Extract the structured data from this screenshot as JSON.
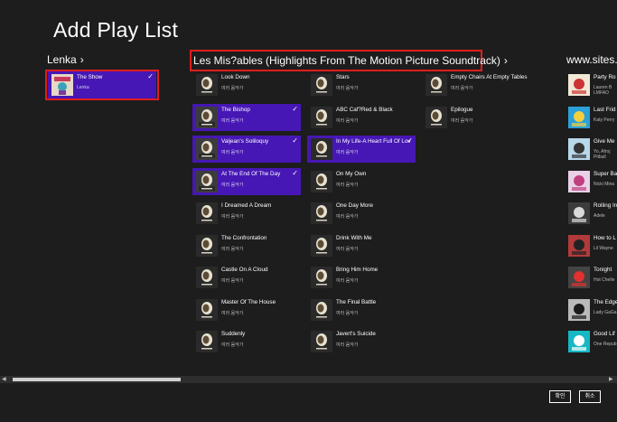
{
  "page_title": "Add Play List",
  "groups": {
    "lenka": "Lenka",
    "lesmis": "Les Mis?ables (Highlights From The Motion Picture Soundtrack)",
    "sites": "www.sites.go"
  },
  "chevron": "›",
  "lenka_items": [
    {
      "title": "The Show",
      "sub": "Lenka"
    }
  ],
  "lesmis_col1": [
    {
      "title": "Look Down",
      "sub": "여러 음악가"
    },
    {
      "title": "The Bishop",
      "sub": "여러 음악가"
    },
    {
      "title": "Valjean's Soliloquy",
      "sub": "여러 음악가"
    },
    {
      "title": "At The End Of The Day",
      "sub": "여러 음악가"
    },
    {
      "title": "I Dreamed A Dream",
      "sub": "여러 음악가"
    },
    {
      "title": "The Confrontation",
      "sub": "여러 음악가"
    },
    {
      "title": "Castle On A Cloud",
      "sub": "여러 음악가"
    },
    {
      "title": "Master Of The House",
      "sub": "여러 음악가"
    },
    {
      "title": "Suddenly",
      "sub": "여러 음악가"
    }
  ],
  "lesmis_col2": [
    {
      "title": "Stars",
      "sub": "여러 음악가"
    },
    {
      "title": "ABC Caf?Red & Black",
      "sub": "여러 음악가"
    },
    {
      "title": "In My Life-A Heart Full Of Lov",
      "sub": "여러 음악가"
    },
    {
      "title": "On My Own",
      "sub": "여러 음악가"
    },
    {
      "title": "One Day More",
      "sub": "여러 음악가"
    },
    {
      "title": "Drink With Me",
      "sub": "여러 음악가"
    },
    {
      "title": "Bring Him Home",
      "sub": "여러 음악가"
    },
    {
      "title": "The Final Battle",
      "sub": "여러 음악가"
    },
    {
      "title": "Javert's Suicide",
      "sub": "여러 음악가"
    }
  ],
  "lesmis_col3": [
    {
      "title": "Empty Chairs At Empty Tables",
      "sub": "여러 음악가"
    },
    {
      "title": "Epilogue",
      "sub": "여러 음악가"
    }
  ],
  "sites_items": [
    {
      "title": "Party Ro",
      "sub": "Lauren B",
      "sub2": "LMFAO"
    },
    {
      "title": "Last Frid",
      "sub": "Katy Perry"
    },
    {
      "title": "Give Me",
      "sub": "Yo, Afroj",
      "sub2": "Pitbull"
    },
    {
      "title": "Super Ba",
      "sub": "Nicki Mina"
    },
    {
      "title": "Rolling In",
      "sub": "Adele"
    },
    {
      "title": "How to L",
      "sub": "Lil Wayne"
    },
    {
      "title": "Tonight",
      "sub": "Hot Chelle"
    },
    {
      "title": "The Edge",
      "sub": "Lady GaGa"
    },
    {
      "title": "Good Lif",
      "sub": "One Repub"
    }
  ],
  "selected": {
    "lenka": [
      0
    ],
    "col1": [
      1,
      2,
      3
    ],
    "col2": [
      2
    ]
  },
  "buttons": {
    "ok": "확인",
    "cancel": "취소"
  },
  "icons": {
    "check": "✓",
    "left_arrow": "◀",
    "right_arrow": "▶"
  },
  "colors": {
    "accent": "#4617b4",
    "highlight_outline": "#e01d1d"
  }
}
